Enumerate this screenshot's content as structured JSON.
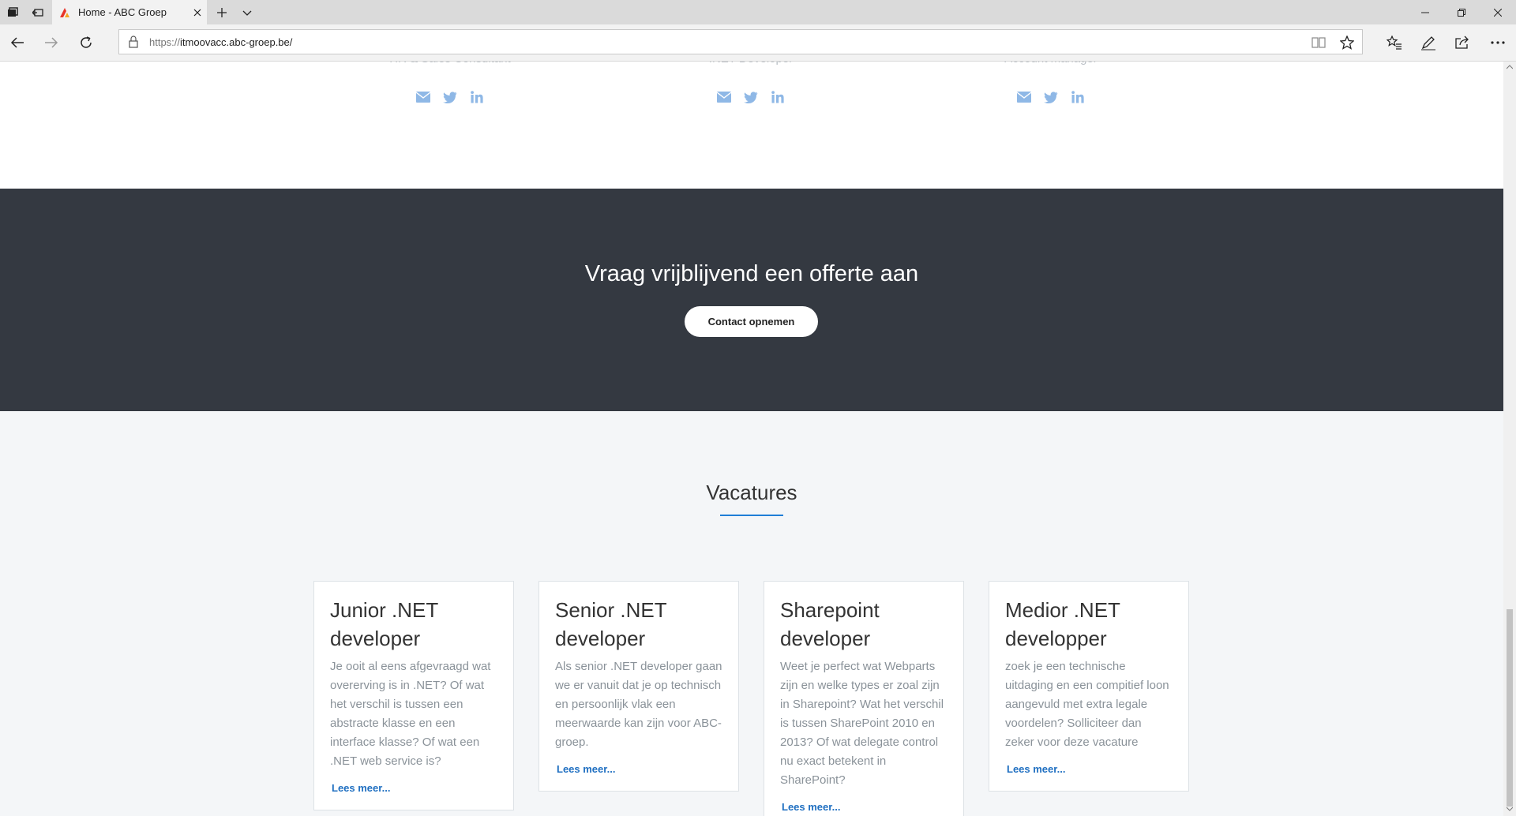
{
  "browser": {
    "tab_title": "Home - ABC Groep",
    "url_protocol": "https://",
    "url_host": "itmoovacc.abc-groep.be/"
  },
  "team": {
    "members": [
      {
        "role": "HR & Sales Consultant"
      },
      {
        "role": ".NET Developer"
      },
      {
        "role": "Account manager"
      }
    ],
    "social_icons": [
      "envelope-icon",
      "twitter-icon",
      "linkedin-icon"
    ]
  },
  "cta": {
    "title": "Vraag vrijblijvend een offerte aan",
    "button_label": "Contact opnemen"
  },
  "vacatures": {
    "heading": "Vacatures",
    "cards": [
      {
        "title": "Junior .NET developer",
        "text": "Je ooit al eens afgevraagd wat overerving is in .NET? Of wat het verschil is tussen een abstracte klasse en een interface klasse? Of wat een .NET web service is?",
        "link": "Lees meer..."
      },
      {
        "title": "Senior .NET developer",
        "text": "Als senior .NET developer gaan we er vanuit dat je op technisch en persoonlijk vlak een meerwaarde kan zijn voor ABC-groep.",
        "link": "Lees meer..."
      },
      {
        "title": "Sharepoint developer",
        "text": "Weet je perfect wat Webparts zijn en welke types er zoal zijn in Sharepoint? Wat het verschil is tussen SharePoint 2010 en 2013? Of wat delegate control nu exact betekent in SharePoint?",
        "link": "Lees meer..."
      },
      {
        "title": "Medior .NET developper",
        "text": "zoek je een technische uitdaging en een compitief loon aangevuld met extra legale voordelen? Solliciteer dan zeker voor deze vacature",
        "link": "Lees meer..."
      }
    ]
  },
  "colors": {
    "accent": "#1f7ed6",
    "cta_background": "#343941",
    "social_icon": "#8fb8e6"
  }
}
